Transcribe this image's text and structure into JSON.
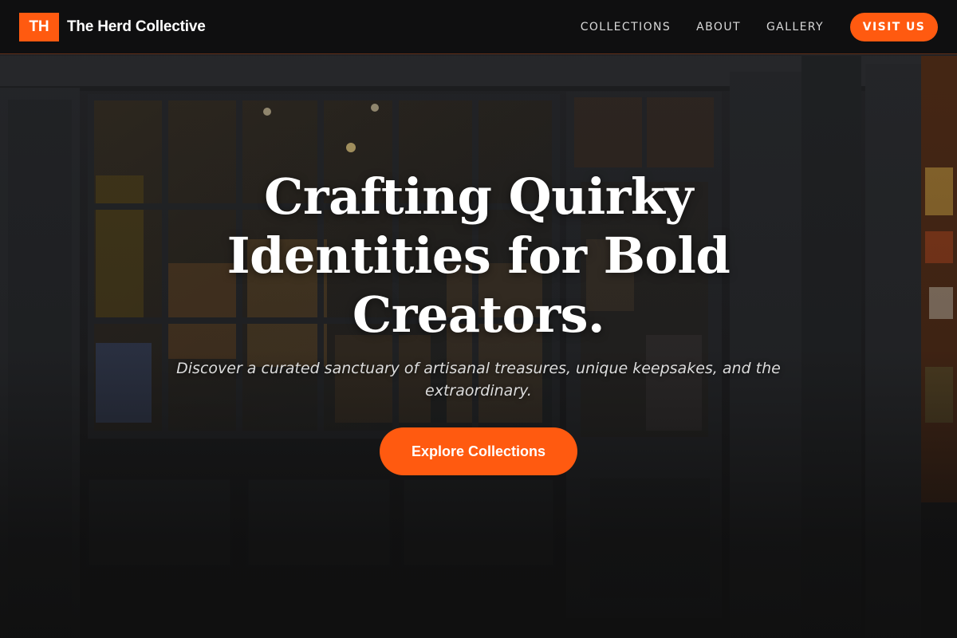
{
  "brand": {
    "mark": "TH",
    "name": "The Herd Collective"
  },
  "nav": {
    "links": [
      "COLLECTIONS",
      "ABOUT",
      "GALLERY"
    ],
    "cta_label": "VISIT US"
  },
  "hero": {
    "title": "Crafting Quirky Identities for Bold Creators.",
    "subtitle": "Discover a curated sanctuary of artisanal treasures, unique keepsakes, and the extraordinary.",
    "cta_label": "Explore Collections",
    "background": "storefront-photo"
  },
  "colors": {
    "accent": "#ff5a10",
    "header_bg": "#0e0e0e",
    "page_bg": "#141414"
  }
}
